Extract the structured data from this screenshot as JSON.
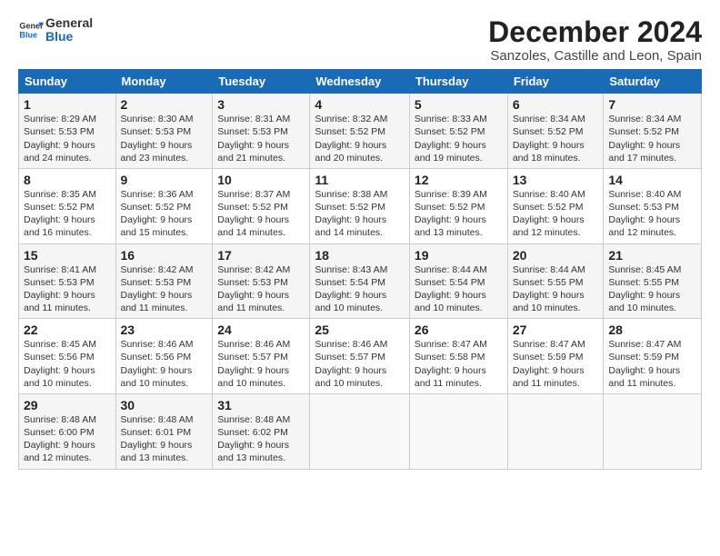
{
  "logo": {
    "text_general": "General",
    "text_blue": "Blue"
  },
  "header": {
    "title": "December 2024",
    "subtitle": "Sanzoles, Castille and Leon, Spain"
  },
  "weekdays": [
    "Sunday",
    "Monday",
    "Tuesday",
    "Wednesday",
    "Thursday",
    "Friday",
    "Saturday"
  ],
  "weeks": [
    [
      {
        "day": "1",
        "sunrise": "Sunrise: 8:29 AM",
        "sunset": "Sunset: 5:53 PM",
        "daylight": "Daylight: 9 hours and 24 minutes."
      },
      {
        "day": "2",
        "sunrise": "Sunrise: 8:30 AM",
        "sunset": "Sunset: 5:53 PM",
        "daylight": "Daylight: 9 hours and 23 minutes."
      },
      {
        "day": "3",
        "sunrise": "Sunrise: 8:31 AM",
        "sunset": "Sunset: 5:53 PM",
        "daylight": "Daylight: 9 hours and 21 minutes."
      },
      {
        "day": "4",
        "sunrise": "Sunrise: 8:32 AM",
        "sunset": "Sunset: 5:52 PM",
        "daylight": "Daylight: 9 hours and 20 minutes."
      },
      {
        "day": "5",
        "sunrise": "Sunrise: 8:33 AM",
        "sunset": "Sunset: 5:52 PM",
        "daylight": "Daylight: 9 hours and 19 minutes."
      },
      {
        "day": "6",
        "sunrise": "Sunrise: 8:34 AM",
        "sunset": "Sunset: 5:52 PM",
        "daylight": "Daylight: 9 hours and 18 minutes."
      },
      {
        "day": "7",
        "sunrise": "Sunrise: 8:34 AM",
        "sunset": "Sunset: 5:52 PM",
        "daylight": "Daylight: 9 hours and 17 minutes."
      }
    ],
    [
      {
        "day": "8",
        "sunrise": "Sunrise: 8:35 AM",
        "sunset": "Sunset: 5:52 PM",
        "daylight": "Daylight: 9 hours and 16 minutes."
      },
      {
        "day": "9",
        "sunrise": "Sunrise: 8:36 AM",
        "sunset": "Sunset: 5:52 PM",
        "daylight": "Daylight: 9 hours and 15 minutes."
      },
      {
        "day": "10",
        "sunrise": "Sunrise: 8:37 AM",
        "sunset": "Sunset: 5:52 PM",
        "daylight": "Daylight: 9 hours and 14 minutes."
      },
      {
        "day": "11",
        "sunrise": "Sunrise: 8:38 AM",
        "sunset": "Sunset: 5:52 PM",
        "daylight": "Daylight: 9 hours and 14 minutes."
      },
      {
        "day": "12",
        "sunrise": "Sunrise: 8:39 AM",
        "sunset": "Sunset: 5:52 PM",
        "daylight": "Daylight: 9 hours and 13 minutes."
      },
      {
        "day": "13",
        "sunrise": "Sunrise: 8:40 AM",
        "sunset": "Sunset: 5:52 PM",
        "daylight": "Daylight: 9 hours and 12 minutes."
      },
      {
        "day": "14",
        "sunrise": "Sunrise: 8:40 AM",
        "sunset": "Sunset: 5:53 PM",
        "daylight": "Daylight: 9 hours and 12 minutes."
      }
    ],
    [
      {
        "day": "15",
        "sunrise": "Sunrise: 8:41 AM",
        "sunset": "Sunset: 5:53 PM",
        "daylight": "Daylight: 9 hours and 11 minutes."
      },
      {
        "day": "16",
        "sunrise": "Sunrise: 8:42 AM",
        "sunset": "Sunset: 5:53 PM",
        "daylight": "Daylight: 9 hours and 11 minutes."
      },
      {
        "day": "17",
        "sunrise": "Sunrise: 8:42 AM",
        "sunset": "Sunset: 5:53 PM",
        "daylight": "Daylight: 9 hours and 11 minutes."
      },
      {
        "day": "18",
        "sunrise": "Sunrise: 8:43 AM",
        "sunset": "Sunset: 5:54 PM",
        "daylight": "Daylight: 9 hours and 10 minutes."
      },
      {
        "day": "19",
        "sunrise": "Sunrise: 8:44 AM",
        "sunset": "Sunset: 5:54 PM",
        "daylight": "Daylight: 9 hours and 10 minutes."
      },
      {
        "day": "20",
        "sunrise": "Sunrise: 8:44 AM",
        "sunset": "Sunset: 5:55 PM",
        "daylight": "Daylight: 9 hours and 10 minutes."
      },
      {
        "day": "21",
        "sunrise": "Sunrise: 8:45 AM",
        "sunset": "Sunset: 5:55 PM",
        "daylight": "Daylight: 9 hours and 10 minutes."
      }
    ],
    [
      {
        "day": "22",
        "sunrise": "Sunrise: 8:45 AM",
        "sunset": "Sunset: 5:56 PM",
        "daylight": "Daylight: 9 hours and 10 minutes."
      },
      {
        "day": "23",
        "sunrise": "Sunrise: 8:46 AM",
        "sunset": "Sunset: 5:56 PM",
        "daylight": "Daylight: 9 hours and 10 minutes."
      },
      {
        "day": "24",
        "sunrise": "Sunrise: 8:46 AM",
        "sunset": "Sunset: 5:57 PM",
        "daylight": "Daylight: 9 hours and 10 minutes."
      },
      {
        "day": "25",
        "sunrise": "Sunrise: 8:46 AM",
        "sunset": "Sunset: 5:57 PM",
        "daylight": "Daylight: 9 hours and 10 minutes."
      },
      {
        "day": "26",
        "sunrise": "Sunrise: 8:47 AM",
        "sunset": "Sunset: 5:58 PM",
        "daylight": "Daylight: 9 hours and 11 minutes."
      },
      {
        "day": "27",
        "sunrise": "Sunrise: 8:47 AM",
        "sunset": "Sunset: 5:59 PM",
        "daylight": "Daylight: 9 hours and 11 minutes."
      },
      {
        "day": "28",
        "sunrise": "Sunrise: 8:47 AM",
        "sunset": "Sunset: 5:59 PM",
        "daylight": "Daylight: 9 hours and 11 minutes."
      }
    ],
    [
      {
        "day": "29",
        "sunrise": "Sunrise: 8:48 AM",
        "sunset": "Sunset: 6:00 PM",
        "daylight": "Daylight: 9 hours and 12 minutes."
      },
      {
        "day": "30",
        "sunrise": "Sunrise: 8:48 AM",
        "sunset": "Sunset: 6:01 PM",
        "daylight": "Daylight: 9 hours and 13 minutes."
      },
      {
        "day": "31",
        "sunrise": "Sunrise: 8:48 AM",
        "sunset": "Sunset: 6:02 PM",
        "daylight": "Daylight: 9 hours and 13 minutes."
      },
      null,
      null,
      null,
      null
    ]
  ]
}
